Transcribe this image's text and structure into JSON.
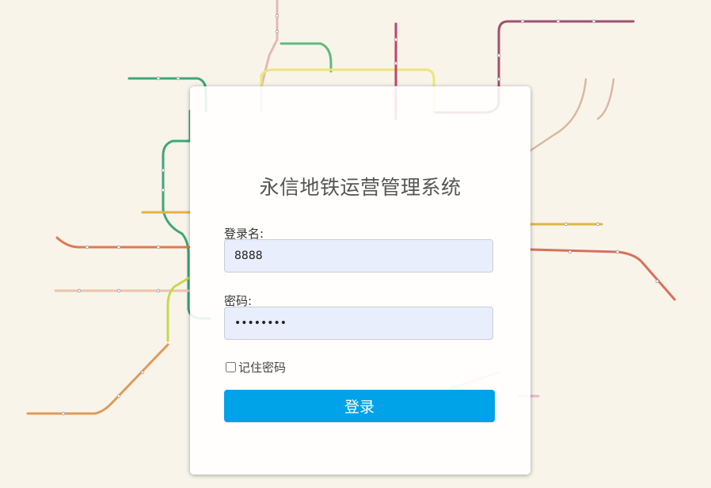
{
  "app": {
    "title": "永信地铁运营管理系统"
  },
  "login_form": {
    "username_label": "登录名:",
    "username_value": "8888",
    "password_label": "密码:",
    "password_value": "12345678",
    "remember_label": "记住密码",
    "remember_checked": false,
    "submit_label": "登录"
  },
  "colors": {
    "page_background": "#f9f4ea",
    "primary_button": "#00a2e8",
    "input_background": "#e8eefb",
    "title_text": "#555555"
  }
}
